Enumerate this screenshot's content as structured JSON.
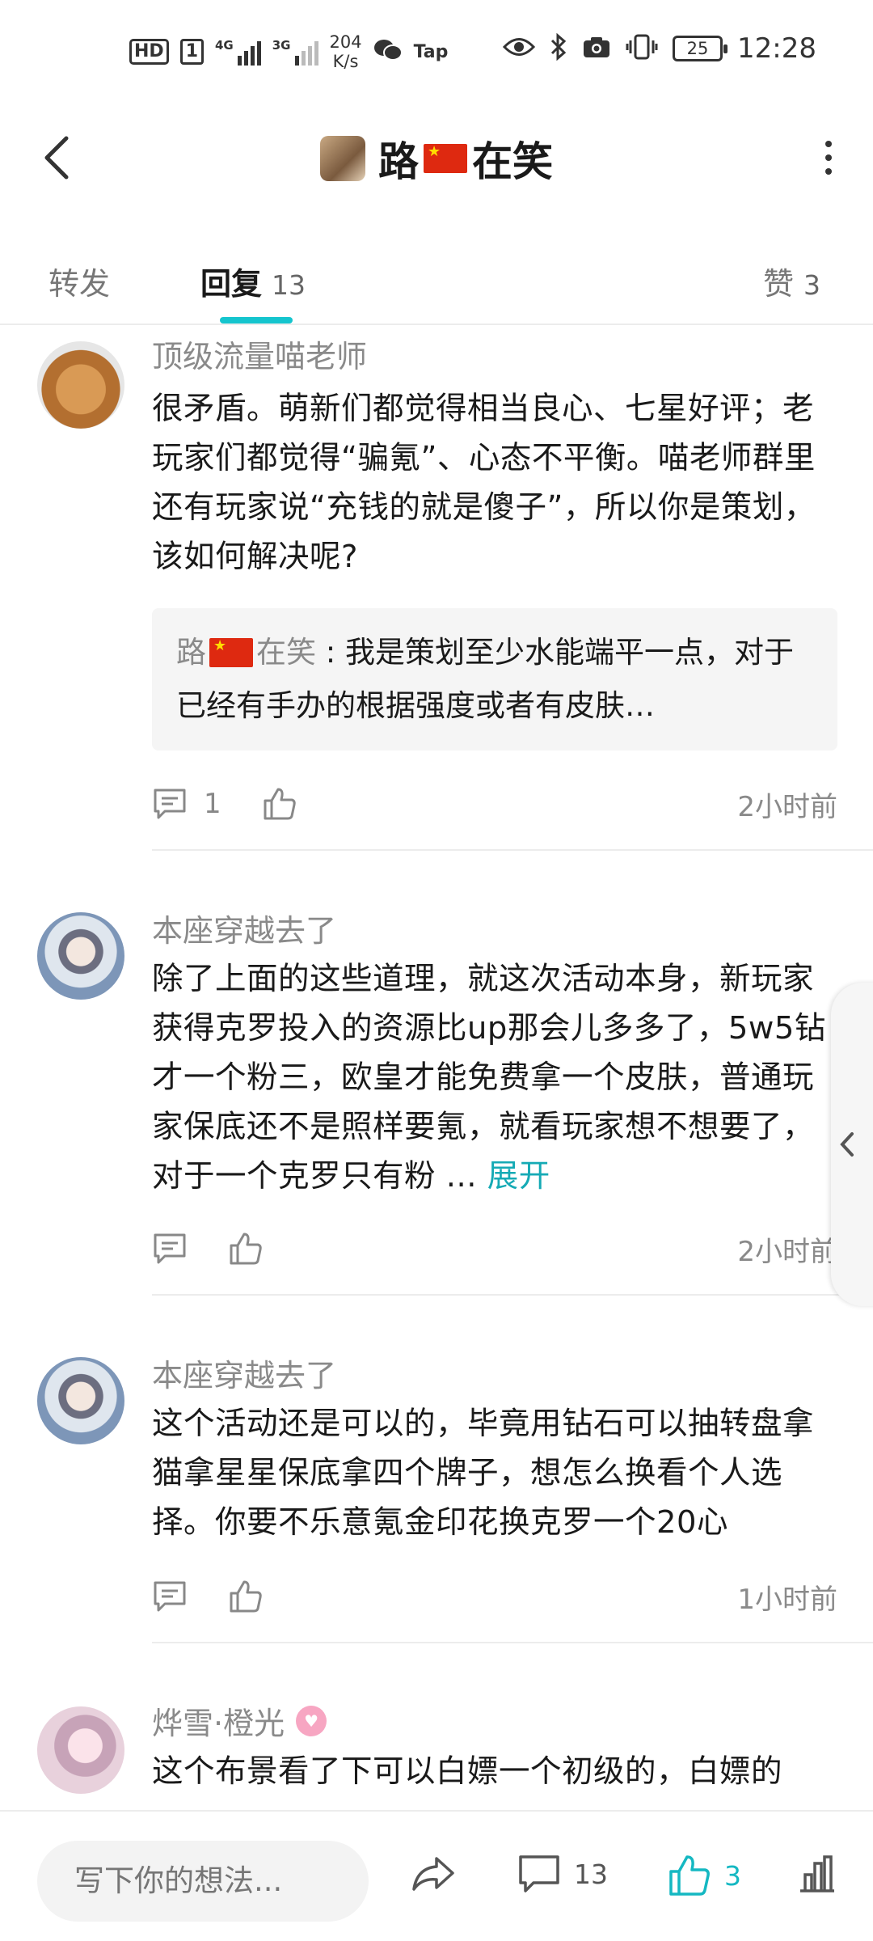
{
  "status_bar": {
    "hd": "HD",
    "sim": "1",
    "net1": "4G",
    "net2": "3G",
    "speed_value": "204",
    "speed_unit": "K/s",
    "tap": "Tap",
    "battery": "25",
    "time": "12:28"
  },
  "header": {
    "title_part1": "路",
    "title_part2": "在笑"
  },
  "tabs": {
    "repost": "转发",
    "reply": "回复",
    "reply_count": "13",
    "like": "赞",
    "like_count": "3"
  },
  "comments": [
    {
      "username": "顶级流量喵老师",
      "content": "很矛盾。萌新们都觉得相当良心、七星好评；老玩家们都觉得“骗氪”、心态不平衡。喵老师群里还有玩家说“充钱的就是傻子”，所以你是策划，该如何解决呢?",
      "quote_author_part1": "路",
      "quote_author_part2": "在笑",
      "quote_sep": " : ",
      "quote_text": "我是策划至少水能端平一点，对于已经有手办的根据强度或者有皮肤…",
      "reply_count": "1",
      "time": "2小时前"
    },
    {
      "username": "本座穿越去了",
      "content": "除了上面的这些道理，就这次活动本身，新玩家获得克罗投入的资源比up那会儿多多了，5w5钻才一个粉三，欧皇才能免费拿一个皮肤，普通玩家保底还不是照样要氪，就看玩家想不想要了，对于一个克罗只有粉 ...",
      "expand": "展开",
      "time": "2小时前"
    },
    {
      "username": "本座穿越去了",
      "content": "这个活动还是可以的，毕竟用钻石可以抽转盘拿猫拿星星保底拿四个牌子，想怎么换看个人选择。你要不乐意氪金印花换克罗一个20心",
      "time": "1小时前"
    },
    {
      "username": "烨雪·橙光",
      "content": "这个布景看了下可以白嫖一个初级的，白嫖的"
    }
  ],
  "bottom_bar": {
    "input_placeholder": "写下你的想法...",
    "comment_count": "13",
    "like_count": "3"
  },
  "colors": {
    "accent": "#15c5ce",
    "like_active": "#15b8c2",
    "secondary_text": "#8a8a8a"
  },
  "icons": [
    "back-icon",
    "more-icon",
    "comment-icon",
    "thumb-up-icon",
    "share-icon",
    "stats-icon",
    "chevron-left-icon",
    "eye-icon",
    "bluetooth-icon",
    "camera-icon",
    "vibrate-icon",
    "wechat-icon"
  ]
}
